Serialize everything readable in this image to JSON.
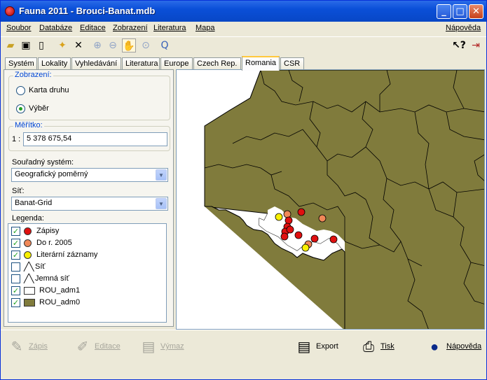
{
  "window": {
    "title": "Fauna 2011 - Brouci-Banat.mdb"
  },
  "menu": {
    "items": [
      "Soubor",
      "Databáze",
      "Editace",
      "Zobrazení",
      "Literatura",
      "Mapa"
    ],
    "help": "Nápověda"
  },
  "toolbar": {
    "icons": [
      "open-folder-icon",
      "save-icon",
      "new-document-icon",
      "new-folder-icon",
      "delete-icon",
      "zoom-in-icon",
      "zoom-out-icon",
      "pan-hand-icon",
      "zoom-extent-icon",
      "query-icon",
      "context-help-icon",
      "exit-icon"
    ]
  },
  "tabs": [
    {
      "label": "Systém"
    },
    {
      "label": "Lokality"
    },
    {
      "label": "Vyhledávání"
    },
    {
      "label": "Literatura"
    },
    {
      "label": "Europe"
    },
    {
      "label": "Czech Rep."
    },
    {
      "label": "Romania"
    },
    {
      "label": "CSR"
    }
  ],
  "active_tab": "Romania",
  "panel": {
    "zobrazeni": {
      "title": "Zobrazení:",
      "option1": "Karta druhu",
      "option2": "Výběr",
      "selected": "Výběr"
    },
    "meritko": {
      "title": "Měřítko:",
      "prefix": "1 :",
      "value": "5 378 675,54"
    },
    "souradny": {
      "label": "Souřadný systém:",
      "value": "Geografický poměrný"
    },
    "sit": {
      "label": "Síť:",
      "value": "Banat-Grid"
    },
    "legenda": {
      "title": "Legenda:",
      "items": [
        {
          "label": "Zápisy",
          "checked": true,
          "color": "#e01010"
        },
        {
          "label": "Do r. 2005",
          "checked": true,
          "color": "#f08858"
        },
        {
          "label": "Literární záznamy",
          "checked": true,
          "color": "#f8f000"
        },
        {
          "label": "Síť",
          "checked": false
        },
        {
          "label": "Jemná síť",
          "checked": false
        },
        {
          "label": "ROU_adm1",
          "checked": true,
          "color": "#ffffff"
        },
        {
          "label": "ROU_adm0",
          "checked": true,
          "color": "#807b3c"
        }
      ]
    }
  },
  "actions": {
    "zapis": "Zápis",
    "editace": "Editace",
    "vymaz": "Výmaz",
    "export": "Export",
    "tisk": "Tisk",
    "napoveda": "Nápověda"
  },
  "map": {
    "land_color": "#807b3c",
    "border_color": "#000000"
  }
}
